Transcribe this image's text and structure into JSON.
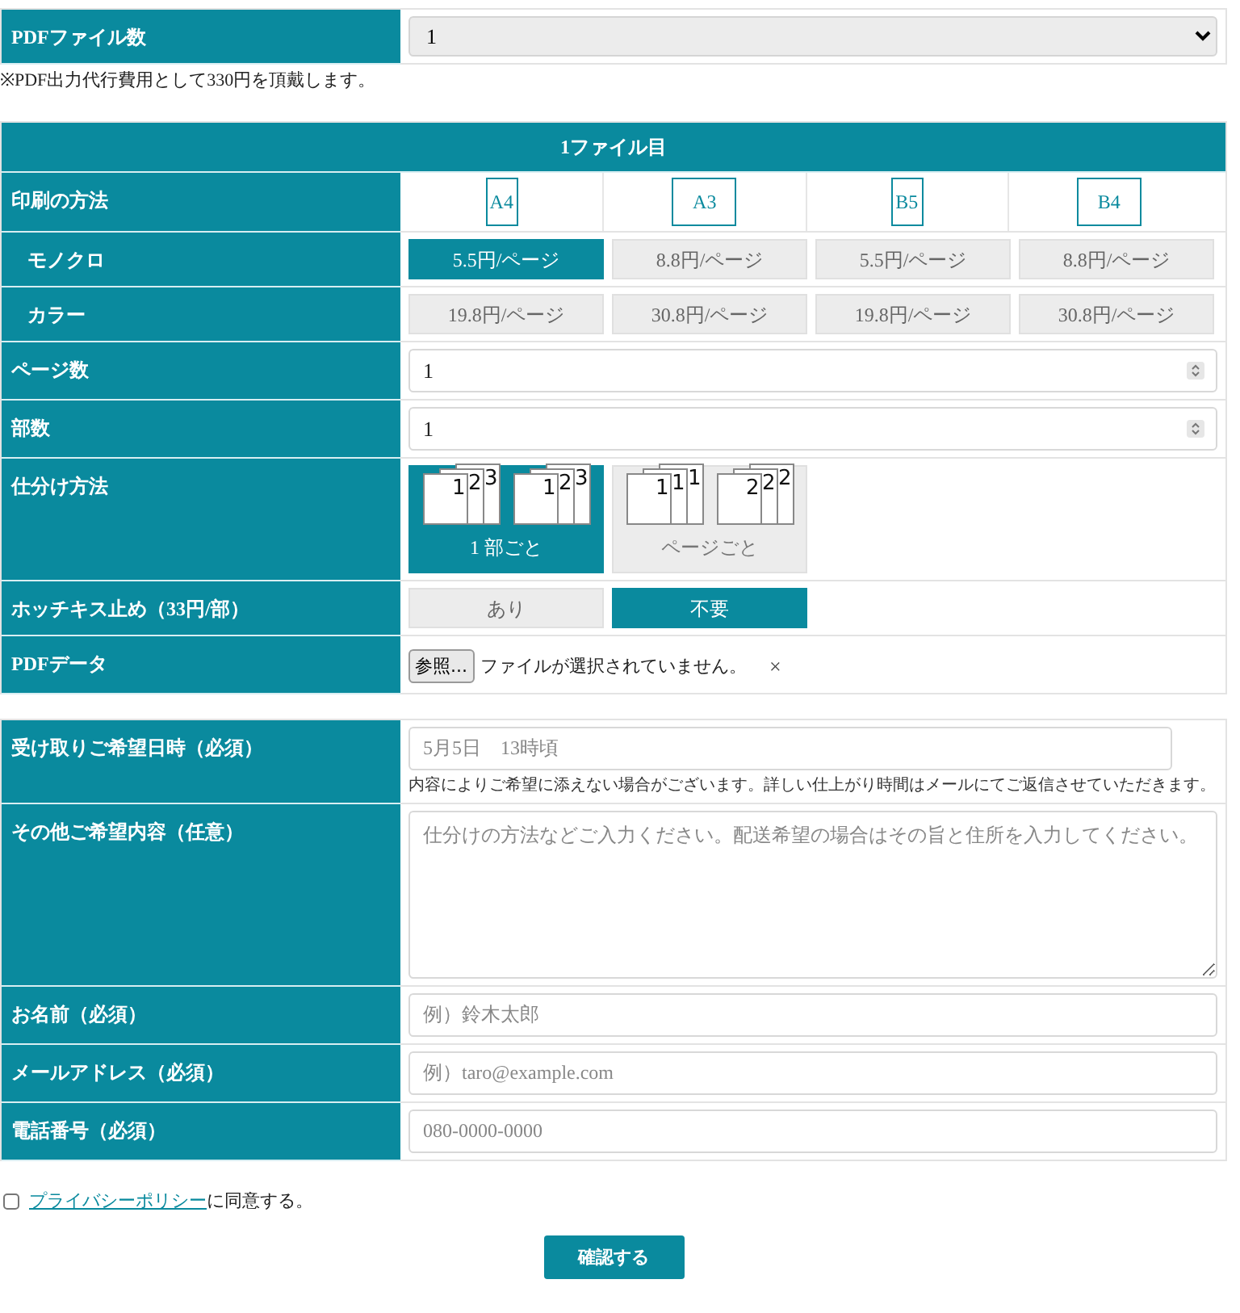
{
  "file_count": {
    "label": "PDFファイル数",
    "value": "1"
  },
  "note": "※PDF出力代行費用として330円を頂戴します。",
  "file_section": {
    "title": "1ファイル目",
    "print_method": {
      "label": "印刷の方法",
      "sizes": [
        {
          "label": "A4",
          "kind": "portrait"
        },
        {
          "label": "A3",
          "kind": "landscape"
        },
        {
          "label": "B5",
          "kind": "portrait"
        },
        {
          "label": "B4",
          "kind": "landscape"
        }
      ]
    },
    "price_rows": [
      {
        "label": "モノクロ",
        "prices": [
          {
            "text": "5.5円/ページ",
            "selected": true
          },
          {
            "text": "8.8円/ページ",
            "selected": false
          },
          {
            "text": "5.5円/ページ",
            "selected": false
          },
          {
            "text": "8.8円/ページ",
            "selected": false
          }
        ]
      },
      {
        "label": "カラー",
        "prices": [
          {
            "text": "19.8円/ページ",
            "selected": false
          },
          {
            "text": "30.8円/ページ",
            "selected": false
          },
          {
            "text": "19.8円/ページ",
            "selected": false
          },
          {
            "text": "30.8円/ページ",
            "selected": false
          }
        ]
      }
    ],
    "page_count": {
      "label": "ページ数",
      "value": "1"
    },
    "copies": {
      "label": "部数",
      "value": "1"
    },
    "sorting": {
      "label": "仕分け方法",
      "options": [
        {
          "label": "1 部ごと",
          "selected": true,
          "stacks": [
            [
              "1",
              "2",
              "3"
            ],
            [
              "1",
              "2",
              "3"
            ]
          ]
        },
        {
          "label": "ページごと",
          "selected": false,
          "stacks": [
            [
              "1",
              "1",
              "1"
            ],
            [
              "2",
              "2",
              "2"
            ]
          ]
        }
      ]
    },
    "staple": {
      "label": "ホッチキス止め（33円/部）",
      "options": [
        {
          "label": "あり",
          "selected": false
        },
        {
          "label": "不要",
          "selected": true
        }
      ]
    },
    "pdf_data": {
      "label": "PDFデータ",
      "button": "参照...",
      "status": "ファイルが選択されていません。",
      "clear": "×"
    }
  },
  "contact": [
    {
      "kind": "input",
      "label": "受け取りご希望日時（必須）",
      "placeholder": "5月5日　13時頃",
      "hint": "内容によりご希望に添えない場合がございます。詳しい仕上がり時間はメールにてご返信させていただきます。"
    },
    {
      "kind": "textarea",
      "label": "その他ご希望内容（任意）",
      "placeholder": "仕分けの方法などご入力ください。配送希望の場合はその旨と住所を入力してください。"
    },
    {
      "kind": "input",
      "label": "お名前（必須）",
      "placeholder": "例）鈴木太郎"
    },
    {
      "kind": "input",
      "label": "メールアドレス（必須）",
      "placeholder": "例）taro@example.com"
    },
    {
      "kind": "input",
      "label": "電話番号（必須）",
      "placeholder": "080-0000-0000"
    }
  ],
  "privacy": {
    "link": "プライバシーポリシー",
    "text": "に同意する。",
    "checked": false
  },
  "submit": "確認する"
}
